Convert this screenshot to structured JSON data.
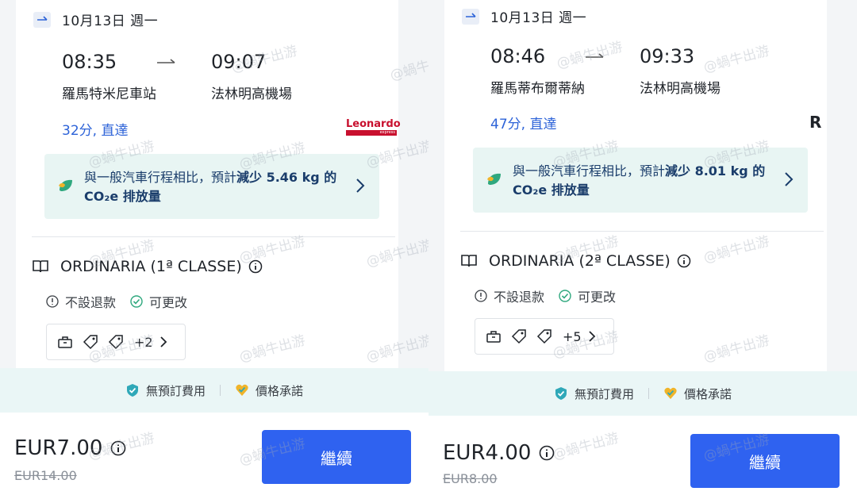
{
  "left": {
    "date": "10月13日 週一",
    "depart_time": "08:35",
    "arrive_time": "09:07",
    "depart_station": "羅馬特米尼車站",
    "arrive_station": "法林明高機場",
    "duration": "32分, 直達",
    "operator_logo_text": "Leonardo",
    "operator_logo_sub": "express",
    "co2_text_a": "與一般汽車行程相比，預計",
    "co2_text_bold": "減少 5.46 kg",
    "co2_text_b": " 的 CO₂e 排放量",
    "class_name": "ORDINARIA (1ª CLASSE)",
    "policy_no_refund": "不設退款",
    "policy_changeable": "可更改",
    "amenities_more": "+2",
    "benefit_1": "無預訂費用",
    "benefit_2": "價格承諾",
    "price": "EUR7.00",
    "old_price": "EUR14.00",
    "continue_label": "繼續"
  },
  "right": {
    "date": "10月13日 週一",
    "depart_time": "08:46",
    "arrive_time": "09:33",
    "depart_station": "羅馬蒂布爾蒂納",
    "arrive_station": "法林明高機場",
    "duration": "47分, 直達",
    "operator_logo_text": "R",
    "co2_text_a": "與一般汽車行程相比，預計",
    "co2_text_bold": "減少 8.01 kg",
    "co2_text_b": " 的 CO₂e 排放量",
    "class_name": "ORDINARIA (2ª CLASSE)",
    "policy_no_refund": "不設退款",
    "policy_changeable": "可更改",
    "amenities_more": "+5",
    "benefit_1": "無預訂費用",
    "benefit_2": "價格承諾",
    "price": "EUR4.00",
    "old_price": "EUR8.00",
    "continue_label": "繼續"
  },
  "watermark": "@蝸牛出游",
  "colors": {
    "accent_blue": "#2f62f0",
    "link_blue": "#2d63d8",
    "co2_bg": "#e8f5f3",
    "benefit_bg": "#eaf6f6",
    "leaf_green": "#2fa87e",
    "leonardo_red": "#c8102e"
  }
}
